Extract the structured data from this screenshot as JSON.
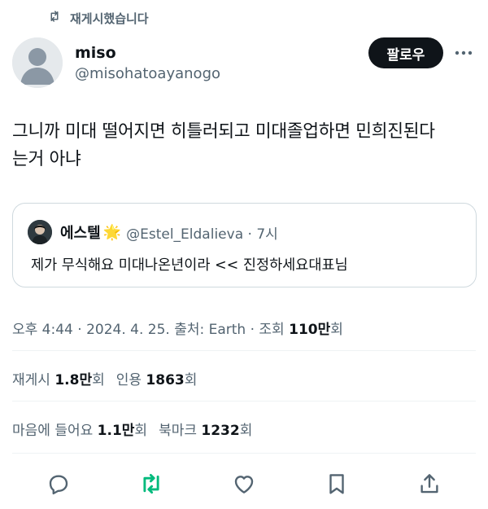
{
  "retweet_context": {
    "label": "재게시했습니다",
    "icon": "retweet-icon"
  },
  "author": {
    "name": "miso",
    "handle": "@misohatoayanogo",
    "follow_label": "팔로우"
  },
  "tweet": {
    "line1": "그니까 미대 떨어지면 히틀러되고 미대졸업하면 민희진된다",
    "line2": "는거 아냐"
  },
  "quote": {
    "name": "에스텔",
    "emoji": "🌟",
    "handle_time": "@Estel_Eldalieva · 7시",
    "text": "제가 무식해요 미대나온년이라 << 진정하세요대표님"
  },
  "meta": {
    "prefix": "오후 4:44 · 2024. 4. 25. 출처: Earth · 조회 ",
    "views": "110만",
    "suffix": "회"
  },
  "stats": {
    "reposts_label": "재게시",
    "reposts_value": "1.8만",
    "reposts_unit": "회",
    "quotes_label": "인용",
    "quotes_value": "1863",
    "quotes_unit": "회",
    "likes_label": "마음에 들어요",
    "likes_value": "1.1만",
    "likes_unit": "회",
    "bookmarks_label": "북마크",
    "bookmarks_value": "1232",
    "bookmarks_unit": "회"
  },
  "colors": {
    "text": "#0f1419",
    "secondary": "#536471",
    "border": "#cfd9de",
    "retweet_active": "#00ba7c"
  },
  "actions": [
    "reply-icon",
    "retweet-icon",
    "like-icon",
    "bookmark-icon",
    "share-icon"
  ]
}
